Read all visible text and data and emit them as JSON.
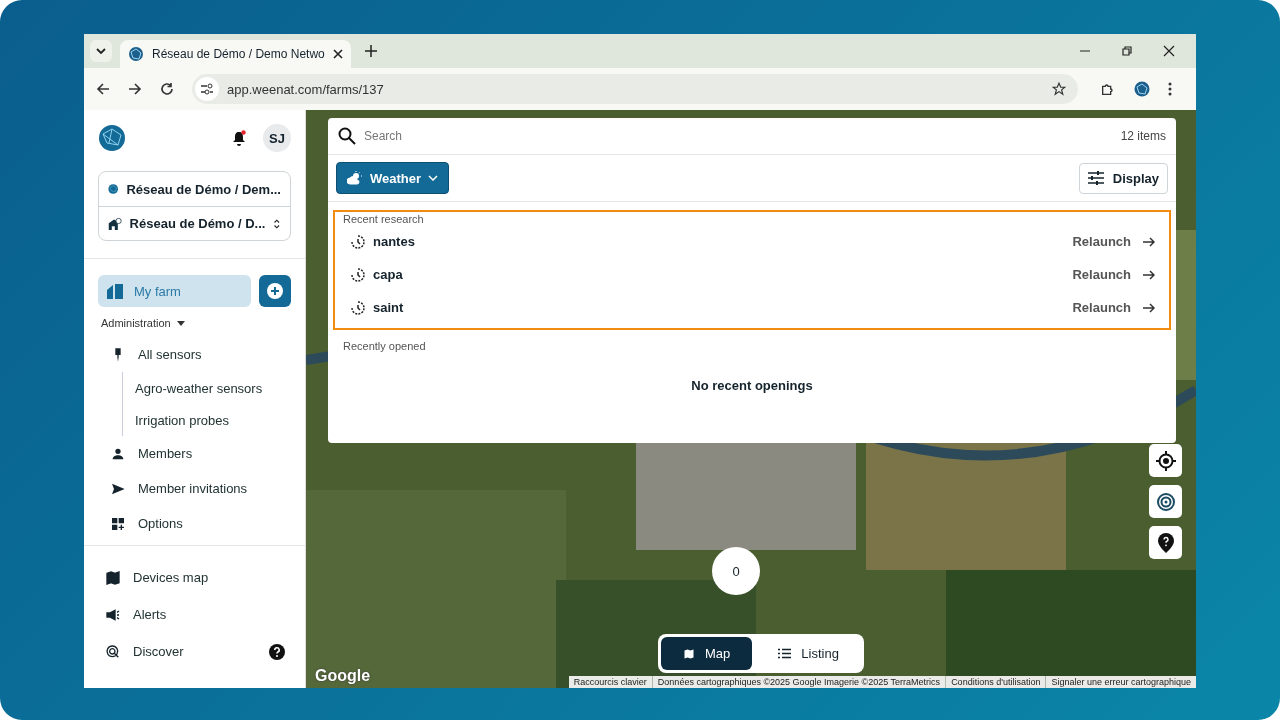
{
  "browser": {
    "tab_title": "Réseau de Démo / Demo Netwo",
    "url": "app.weenat.com/farms/137"
  },
  "sidebar": {
    "avatar": "SJ",
    "notification_unread": true,
    "selectors": [
      {
        "label": "Réseau de Démo / Dem..."
      },
      {
        "label": "Réseau de Démo / D..."
      }
    ],
    "primary": {
      "label": "My farm",
      "selected": true
    },
    "section": "Administration",
    "nav": [
      {
        "label": "All sensors",
        "kind": "item"
      },
      {
        "label": "Agro-weather sensors",
        "kind": "subitem"
      },
      {
        "label": "Irrigation probes",
        "kind": "subitem"
      },
      {
        "label": "Members",
        "kind": "item"
      },
      {
        "label": "Member invitations",
        "kind": "item"
      },
      {
        "label": "Options",
        "kind": "item"
      }
    ],
    "bottom": [
      {
        "label": "Devices map"
      },
      {
        "label": "Alerts"
      },
      {
        "label": "Discover"
      }
    ]
  },
  "search": {
    "placeholder": "Search",
    "count": "12 items"
  },
  "filter": {
    "label": "Weather"
  },
  "display_button": "Display",
  "recent_research": {
    "title": "Recent research",
    "highlighted": true,
    "items": [
      {
        "query": "nantes",
        "action": "Relaunch"
      },
      {
        "query": "capa",
        "action": "Relaunch"
      },
      {
        "query": "saint",
        "action": "Relaunch"
      }
    ]
  },
  "recently_opened": {
    "title": "Recently opened",
    "empty": "No recent openings"
  },
  "map": {
    "cluster_count": "0",
    "logo": "Google",
    "view_toggle": [
      {
        "label": "Map",
        "selected": true
      },
      {
        "label": "Listing",
        "selected": false
      }
    ],
    "attribution": [
      "Raccourcis clavier",
      "Données cartographiques ©2025 Google Imagerie ©2025 TerraMetrics",
      "Conditions d'utilisation",
      "Signaler une erreur cartographique"
    ]
  }
}
